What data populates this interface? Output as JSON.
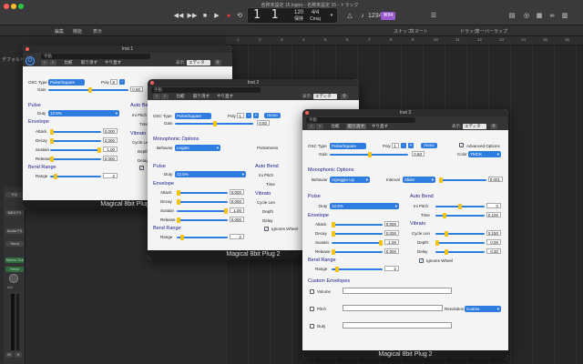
{
  "logic": {
    "window_title": "名称未設定 15.logicx - 名称未設定 15 - トラック",
    "bar_position": "1 1",
    "tempo": "120",
    "tempo_label": "保持",
    "time_signature": "4/4",
    "key": "Cmaj",
    "user_badge": "⌘84",
    "toolbar_left": [
      "編集",
      "機能",
      "表示"
    ],
    "snap_label": "スナップ:",
    "snap_value": "スマート",
    "drag_label": "ドラッグ:",
    "drag_value": "オーバーラップ",
    "left_panel_label": "デフォルト",
    "ruler_ticks": [
      "1",
      "2",
      "3",
      "4",
      "5",
      "6",
      "7",
      "8",
      "9",
      "10",
      "11",
      "12",
      "13",
      "14",
      "15",
      "16"
    ],
    "strip": {
      "eq": "EQ",
      "midi_fx": "MIDI FX",
      "audio_fx": "Audio FX",
      "send": "Send",
      "stereo_out": "Stereo Out",
      "read": "Read",
      "read2": "Read",
      "value_a": "0.0",
      "value_b": "0.0",
      "m": "M",
      "s": "S",
      "bnc": "Bnc"
    }
  },
  "windows": [
    {
      "id": "inst1",
      "title": "Inst 1",
      "preset": "手動",
      "compare": "比較",
      "undo": "取り消す",
      "redo": "やり直す",
      "view_label": "表示:",
      "view_value": "エディタ",
      "osc_type_label": "OSC Type",
      "osc_type_value": "Pulse/Square",
      "poly_label": "Poly",
      "poly_value": "8",
      "gain_label": "Gain",
      "gain_value": "0.50",
      "pulse_label": "Pulse",
      "duty_label": "Duty",
      "duty_value": "12.5%",
      "envelope_label": "Envelope",
      "attack_label": "Attack",
      "attack_value": "0.000",
      "decay_label": "Decay",
      "decay_value": "0.000",
      "sustain_label": "Sustain",
      "sustain_value": "1.00",
      "release_label": "Release",
      "release_value": "0.000",
      "bend_range_label": "Bend Range",
      "range_label": "Range",
      "range_value": "2",
      "auto_bend_label": "Auto Bend",
      "ini_pitch_label": "Ini Pitch",
      "time_label": "Time",
      "vibrato_label": "Vibrato",
      "cycle_len_label": "Cycle Len",
      "depth_label": "Depth",
      "delay_label": "Delay",
      "footer": "Magical 8bit Plug 2"
    },
    {
      "id": "inst2",
      "title": "Inst 2",
      "preset": "手動",
      "compare": "比較",
      "undo": "取り消す",
      "redo": "やり直す",
      "view_label": "表示:",
      "view_value": "エディタ",
      "osc_type_label": "OSC Type",
      "osc_type_value": "Pulse/Square",
      "poly_label": "Poly",
      "poly_value": "1",
      "mono_label": "mono",
      "gain_label": "Gain",
      "gain_value": "0.50",
      "monophonic_label": "Monophonic Options",
      "behavior_label": "Behavior",
      "behavior_value": "Legato",
      "portamento_label": "Portamento",
      "pulse_label": "Pulse",
      "duty_label": "Duty",
      "duty_value": "12.5%",
      "envelope_label": "Envelope",
      "attack_label": "Attack",
      "attack_value": "0.000",
      "decay_label": "Decay",
      "decay_value": "0.000",
      "sustain_label": "Sustain",
      "sustain_value": "1.00",
      "release_label": "Release",
      "release_value": "0.000",
      "bend_range_label": "Bend Range",
      "range_label": "Range",
      "range_value": "2",
      "auto_bend_label": "Auto Bend",
      "ini_pitch_label": "Ini Pitch",
      "time_label": "Time",
      "vibrato_label": "Vibrato",
      "cycle_len_label": "Cycle Len",
      "depth_label": "Depth",
      "delay_label": "Delay",
      "ignores_wheel_label": "Ignores Wheel",
      "footer": "Magical 8bit Plug 2"
    },
    {
      "id": "inst3",
      "title": "Inst 3",
      "preset": "手動",
      "compare": "比較",
      "undo": "取り消す",
      "redo": "やり直す",
      "view_label": "表示:",
      "view_value": "エディタ",
      "osc_type_label": "OSC Type",
      "osc_type_value": "Pulse/Square",
      "poly_label": "Poly",
      "poly_value": "1",
      "mono_label": "mono",
      "advanced_label": "Advanced Options",
      "gain_label": "Gain",
      "gain_value": "0.50",
      "color_label": "Color",
      "color_value": "YMCK",
      "monophonic_label": "Monophonic Options",
      "behavior_label": "Behavior",
      "behavior_value": "Arpeggio Up",
      "interval_label": "Interval",
      "interval_value": "Slider",
      "interval_num": "0.001",
      "pulse_label": "Pulse",
      "duty_label": "Duty",
      "duty_value": "12.5%",
      "envelope_label": "Envelope",
      "attack_label": "Attack",
      "attack_value": "0.000",
      "decay_label": "Decay",
      "decay_value": "0.000",
      "sustain_label": "Sustain",
      "sustain_value": "1.00",
      "release_label": "Release",
      "release_value": "0.000",
      "bend_range_label": "Bend Range",
      "range_label": "Range",
      "range_value": "2",
      "auto_bend_label": "Auto Bend",
      "ini_pitch_label": "Ini Pitch",
      "ini_pitch_value": "0",
      "time_label": "Time",
      "time_value": "0.100",
      "vibrato_label": "Vibrato",
      "cycle_len_label": "Cycle Len",
      "cycle_len_value": "0.150",
      "depth_label": "Depth",
      "depth_value": "0.00",
      "delay_label": "Delay",
      "delay_value": "0.30",
      "ignores_wheel_label": "Ignores Wheel",
      "custom_env_label": "Custom Envelopes",
      "volume_label": "Volume",
      "pitch_label": "Pitch",
      "duty_env_label": "Duty",
      "resolution_label": "Resolution",
      "resolution_value": "Coarse",
      "footer": "Magical 8bit Plug 2"
    }
  ]
}
